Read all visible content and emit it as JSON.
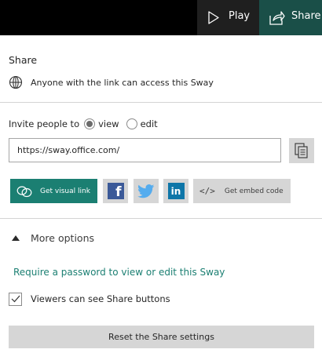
{
  "topbar": {
    "play_label": "Play",
    "share_label": "Share"
  },
  "panel": {
    "title": "Share",
    "access_text": "Anyone with the link can access this Sway"
  },
  "invite": {
    "label": "Invite people to",
    "options": [
      {
        "label": "view",
        "selected": true
      },
      {
        "label": "edit",
        "selected": false
      }
    ],
    "url": "https://sway.office.com/"
  },
  "share_buttons": {
    "visual_link_label": "Get visual link",
    "facebook_glyph": "f",
    "linkedin_glyph": "in",
    "embed_glyph": "</>",
    "embed_label": "Get embed code"
  },
  "more_options": {
    "label": "More options",
    "password_link": "Require a password to view or edit this Sway",
    "viewers_label": "Viewers can see Share buttons",
    "viewers_checked": true,
    "reset_label": "Reset the Share settings"
  },
  "colors": {
    "accent": "#1b7f72",
    "share_header": "#1a4f48",
    "facebook": "#3b5998",
    "twitter": "#55acee",
    "linkedin": "#0e76a8",
    "button_gray": "#d6d6d6"
  }
}
